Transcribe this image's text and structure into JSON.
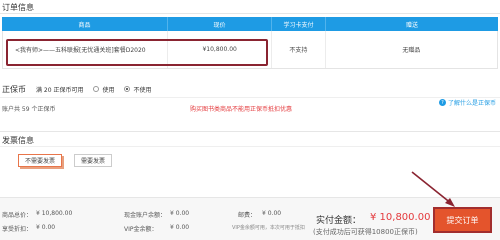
{
  "order_info": {
    "title": "订单信息",
    "columns": [
      "商品",
      "现价",
      "学习卡支付",
      "赠送"
    ],
    "row": {
      "product": "<我有师>——五科联报[无忧通关班]套餐D2020",
      "price": "¥10,800.00",
      "card_pay": "不支持",
      "gift": "无赠品"
    }
  },
  "coin": {
    "title": "正保币",
    "available": "满 20 正保币可用",
    "use_label": "使用",
    "nouse_label": "不使用",
    "selected": "不使用",
    "balance_text": "账户共 59 个正保币",
    "warning": "购买图书类商品不能用正保币抵扣优惠",
    "understand": "了解什么是正保币"
  },
  "invoice": {
    "title": "发票信息",
    "no_invoice": "不需要发票",
    "need_invoice": "需要发票"
  },
  "footer": {
    "goods_total_label": "商品总价：",
    "goods_total": "¥ 10,800.00",
    "discount_label": "享受折扣：",
    "discount": "¥ 0.00",
    "cash_label": "现金账户余额：",
    "cash": "¥ 0.00",
    "vip_label": "VIP金余额：",
    "vip": "¥ 0.00",
    "postage_label": "邮费：",
    "postage": "¥ 0.00",
    "vip_note": "VIP金余额可用，本次可用于抵扣",
    "pay_label": "实付金额：",
    "pay_amount": "¥ 10,800.00",
    "pay_note": "(支付成功后可获得10800正保币)",
    "submit": "提交订单"
  },
  "colors": {
    "header_blue": "#1e9be4",
    "accent_red": "#e4393c",
    "submit_bg": "#e4542c",
    "highlight_border": "#8a2431"
  }
}
